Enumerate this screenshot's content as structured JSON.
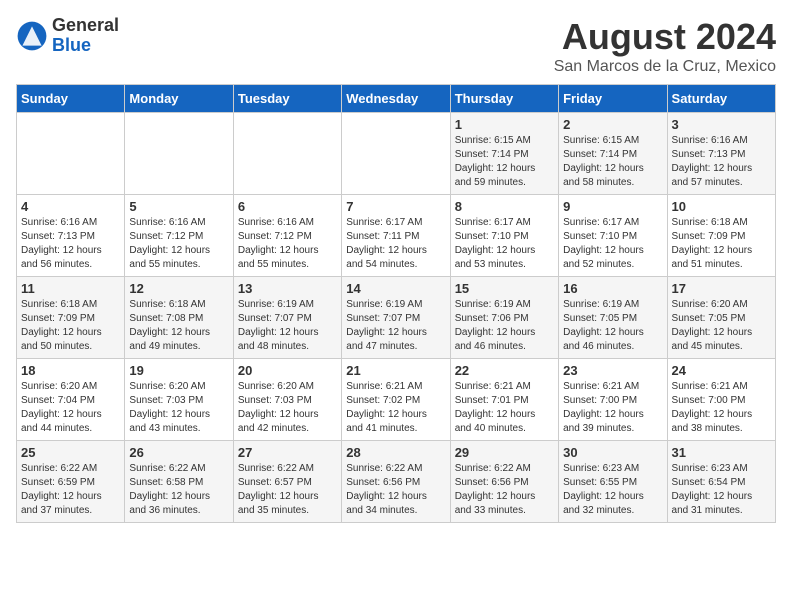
{
  "header": {
    "logo_general": "General",
    "logo_blue": "Blue",
    "month_year": "August 2024",
    "location": "San Marcos de la Cruz, Mexico"
  },
  "weekdays": [
    "Sunday",
    "Monday",
    "Tuesday",
    "Wednesday",
    "Thursday",
    "Friday",
    "Saturday"
  ],
  "weeks": [
    [
      {
        "day": "",
        "info": ""
      },
      {
        "day": "",
        "info": ""
      },
      {
        "day": "",
        "info": ""
      },
      {
        "day": "",
        "info": ""
      },
      {
        "day": "1",
        "info": "Sunrise: 6:15 AM\nSunset: 7:14 PM\nDaylight: 12 hours\nand 59 minutes."
      },
      {
        "day": "2",
        "info": "Sunrise: 6:15 AM\nSunset: 7:14 PM\nDaylight: 12 hours\nand 58 minutes."
      },
      {
        "day": "3",
        "info": "Sunrise: 6:16 AM\nSunset: 7:13 PM\nDaylight: 12 hours\nand 57 minutes."
      }
    ],
    [
      {
        "day": "4",
        "info": "Sunrise: 6:16 AM\nSunset: 7:13 PM\nDaylight: 12 hours\nand 56 minutes."
      },
      {
        "day": "5",
        "info": "Sunrise: 6:16 AM\nSunset: 7:12 PM\nDaylight: 12 hours\nand 55 minutes."
      },
      {
        "day": "6",
        "info": "Sunrise: 6:16 AM\nSunset: 7:12 PM\nDaylight: 12 hours\nand 55 minutes."
      },
      {
        "day": "7",
        "info": "Sunrise: 6:17 AM\nSunset: 7:11 PM\nDaylight: 12 hours\nand 54 minutes."
      },
      {
        "day": "8",
        "info": "Sunrise: 6:17 AM\nSunset: 7:10 PM\nDaylight: 12 hours\nand 53 minutes."
      },
      {
        "day": "9",
        "info": "Sunrise: 6:17 AM\nSunset: 7:10 PM\nDaylight: 12 hours\nand 52 minutes."
      },
      {
        "day": "10",
        "info": "Sunrise: 6:18 AM\nSunset: 7:09 PM\nDaylight: 12 hours\nand 51 minutes."
      }
    ],
    [
      {
        "day": "11",
        "info": "Sunrise: 6:18 AM\nSunset: 7:09 PM\nDaylight: 12 hours\nand 50 minutes."
      },
      {
        "day": "12",
        "info": "Sunrise: 6:18 AM\nSunset: 7:08 PM\nDaylight: 12 hours\nand 49 minutes."
      },
      {
        "day": "13",
        "info": "Sunrise: 6:19 AM\nSunset: 7:07 PM\nDaylight: 12 hours\nand 48 minutes."
      },
      {
        "day": "14",
        "info": "Sunrise: 6:19 AM\nSunset: 7:07 PM\nDaylight: 12 hours\nand 47 minutes."
      },
      {
        "day": "15",
        "info": "Sunrise: 6:19 AM\nSunset: 7:06 PM\nDaylight: 12 hours\nand 46 minutes."
      },
      {
        "day": "16",
        "info": "Sunrise: 6:19 AM\nSunset: 7:05 PM\nDaylight: 12 hours\nand 46 minutes."
      },
      {
        "day": "17",
        "info": "Sunrise: 6:20 AM\nSunset: 7:05 PM\nDaylight: 12 hours\nand 45 minutes."
      }
    ],
    [
      {
        "day": "18",
        "info": "Sunrise: 6:20 AM\nSunset: 7:04 PM\nDaylight: 12 hours\nand 44 minutes."
      },
      {
        "day": "19",
        "info": "Sunrise: 6:20 AM\nSunset: 7:03 PM\nDaylight: 12 hours\nand 43 minutes."
      },
      {
        "day": "20",
        "info": "Sunrise: 6:20 AM\nSunset: 7:03 PM\nDaylight: 12 hours\nand 42 minutes."
      },
      {
        "day": "21",
        "info": "Sunrise: 6:21 AM\nSunset: 7:02 PM\nDaylight: 12 hours\nand 41 minutes."
      },
      {
        "day": "22",
        "info": "Sunrise: 6:21 AM\nSunset: 7:01 PM\nDaylight: 12 hours\nand 40 minutes."
      },
      {
        "day": "23",
        "info": "Sunrise: 6:21 AM\nSunset: 7:00 PM\nDaylight: 12 hours\nand 39 minutes."
      },
      {
        "day": "24",
        "info": "Sunrise: 6:21 AM\nSunset: 7:00 PM\nDaylight: 12 hours\nand 38 minutes."
      }
    ],
    [
      {
        "day": "25",
        "info": "Sunrise: 6:22 AM\nSunset: 6:59 PM\nDaylight: 12 hours\nand 37 minutes."
      },
      {
        "day": "26",
        "info": "Sunrise: 6:22 AM\nSunset: 6:58 PM\nDaylight: 12 hours\nand 36 minutes."
      },
      {
        "day": "27",
        "info": "Sunrise: 6:22 AM\nSunset: 6:57 PM\nDaylight: 12 hours\nand 35 minutes."
      },
      {
        "day": "28",
        "info": "Sunrise: 6:22 AM\nSunset: 6:56 PM\nDaylight: 12 hours\nand 34 minutes."
      },
      {
        "day": "29",
        "info": "Sunrise: 6:22 AM\nSunset: 6:56 PM\nDaylight: 12 hours\nand 33 minutes."
      },
      {
        "day": "30",
        "info": "Sunrise: 6:23 AM\nSunset: 6:55 PM\nDaylight: 12 hours\nand 32 minutes."
      },
      {
        "day": "31",
        "info": "Sunrise: 6:23 AM\nSunset: 6:54 PM\nDaylight: 12 hours\nand 31 minutes."
      }
    ]
  ]
}
